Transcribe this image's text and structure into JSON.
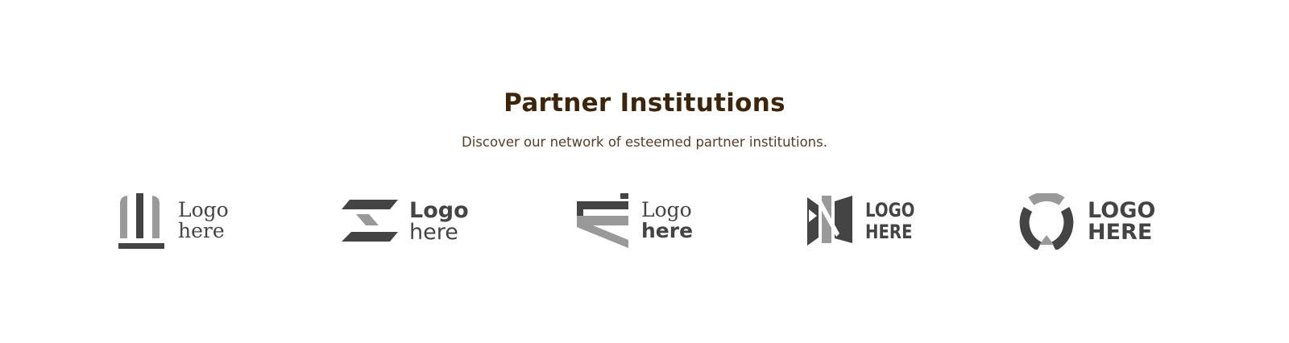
{
  "header": {
    "title": "Partner Institutions",
    "subtitle": "Discover our network of esteemed partner institutions."
  },
  "logos": [
    {
      "line1": "Logo",
      "line2": "here",
      "icon": "pillars-icon"
    },
    {
      "line1": "Logo",
      "line2": "here",
      "icon": "z-shape-icon"
    },
    {
      "line1": "Logo",
      "line2": "here",
      "icon": "bracket-icon"
    },
    {
      "line1": "LOGO",
      "line2": "HERE",
      "icon": "bowtie-icon"
    },
    {
      "line1": "LOGO",
      "line2": "HERE",
      "icon": "ring-icon"
    }
  ],
  "colors": {
    "title": "#3e2409",
    "subtitle": "#5a3b22",
    "logo_dark": "#444444",
    "logo_light": "#999999"
  }
}
